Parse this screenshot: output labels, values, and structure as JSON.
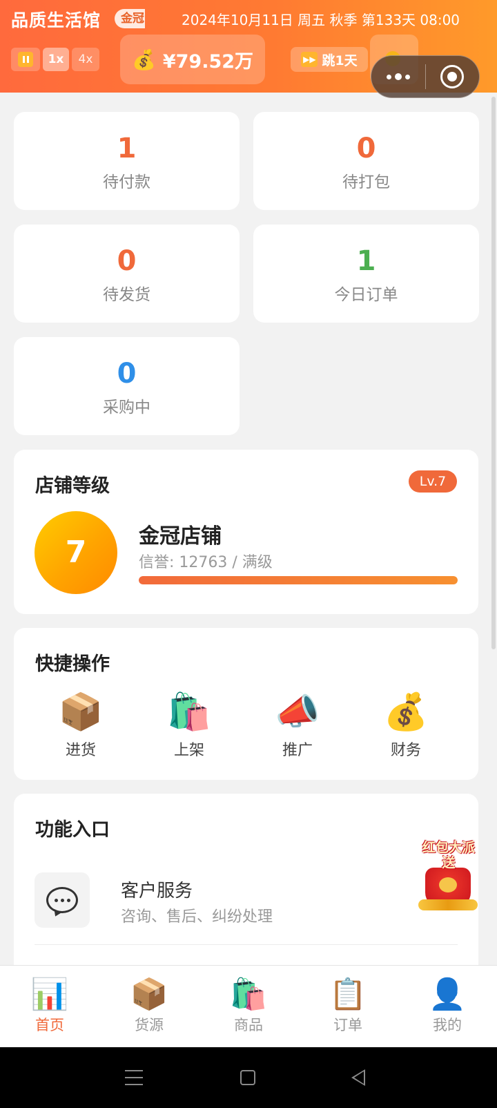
{
  "header": {
    "store_name": "品质生活馆",
    "rank_badge": "金冠",
    "date_line": "2024年10月11日 周五 秋季 第133天 08:00",
    "speed_1x": "1x",
    "speed_4x": "4x",
    "money_icon": "💰",
    "money": "¥79.52万",
    "skip_icon": "⏩",
    "skip_label": "跳1天"
  },
  "stats": [
    {
      "value": "1",
      "label": "待付款",
      "color": "#f0693a"
    },
    {
      "value": "0",
      "label": "待打包",
      "color": "#f0693a"
    },
    {
      "value": "0",
      "label": "待发货",
      "color": "#f0693a"
    },
    {
      "value": "1",
      "label": "今日订单",
      "color": "#4caf50"
    },
    {
      "value": "0",
      "label": "采购中",
      "color": "#2f8fe8"
    }
  ],
  "level": {
    "title": "店铺等级",
    "badge": "Lv.7",
    "number": "7",
    "name": "金冠店铺",
    "credit": "信誉: 12763 / 满级",
    "progress": 1.0
  },
  "quick": {
    "title": "快捷操作",
    "items": [
      {
        "icon": "📦",
        "label": "进货",
        "icon_name": "package-icon"
      },
      {
        "icon": "🛍️",
        "label": "上架",
        "icon_name": "shopping-bags-icon"
      },
      {
        "icon": "📣",
        "label": "推广",
        "icon_name": "megaphone-icon"
      },
      {
        "icon": "💰",
        "label": "财务",
        "icon_name": "money-bag-icon"
      }
    ]
  },
  "features": {
    "title": "功能入口",
    "items": [
      {
        "title": "客户服务",
        "desc": "咨询、售后、纠纷处理",
        "icon_name": "chat-bubble-icon"
      }
    ]
  },
  "red_packet": {
    "text": "红包大派送"
  },
  "tabs": [
    {
      "icon": "📊",
      "label": "首页",
      "active": true,
      "icon_name": "bar-chart-icon"
    },
    {
      "icon": "📦",
      "label": "货源",
      "active": false,
      "icon_name": "package-icon"
    },
    {
      "icon": "🛍️",
      "label": "商品",
      "active": false,
      "icon_name": "shopping-bags-icon"
    },
    {
      "icon": "📋",
      "label": "订单",
      "active": false,
      "icon_name": "clipboard-icon"
    },
    {
      "icon": "👤",
      "label": "我的",
      "active": false,
      "icon_name": "user-icon"
    }
  ],
  "colors": {
    "accent": "#f0693a",
    "header_start": "#ff6a3d",
    "header_end": "#ff9a2a"
  }
}
